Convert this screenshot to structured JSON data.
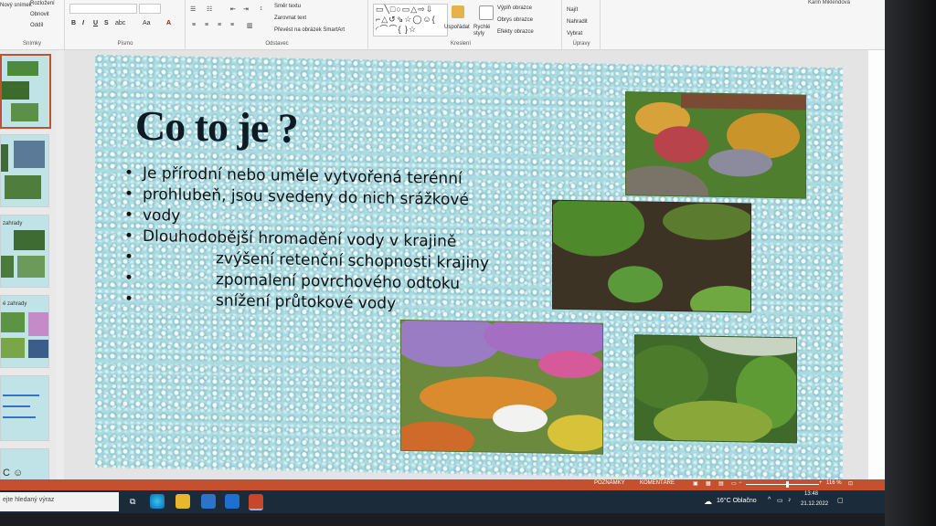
{
  "ribbon": {
    "slides_group": {
      "layout": "Rozložení",
      "reset": "Obnovit",
      "new_slide": "Nový snímek",
      "section": "Oddíl",
      "label": "Snímky"
    },
    "font_group": {
      "label": "Písmo"
    },
    "paragraph_group": {
      "text_direction": "Směr textu",
      "align_text": "Zarovnat text",
      "convert_smartart": "Převést na obrázek SmartArt",
      "label": "Odstavec"
    },
    "drawing_group": {
      "arrange": "Uspořádat",
      "quick_styles": "Rychlé styly",
      "shape_fill": "Výplň obrazce",
      "shape_outline": "Obrys obrazce",
      "shape_effects": "Efekty obrazce",
      "label": "Kreslení"
    },
    "editing_group": {
      "find": "Najít",
      "replace": "Nahradit",
      "select": "Vybrat",
      "label": "Úpravy"
    },
    "user": "Karin Miklendová"
  },
  "left_panel": {
    "thumb3_text": "zahrady",
    "thumb4_text": "é zahrady",
    "bottom_text": "C ☺"
  },
  "slide": {
    "title": "Co to je ?",
    "bullets": [
      {
        "text": "Je přírodní nebo uměle vytvořená terénní"
      },
      {
        "text": "prohlubeň, jsou svedeny do nich srážkové"
      },
      {
        "text": "vody"
      },
      {
        "text": "Dlouhodobější hromadění vody v krajině"
      },
      {
        "text": "zvýšení retenční schopnosti krajiny"
      },
      {
        "text": "zpomalení povrchového odtoku"
      },
      {
        "text": "snížení průtokové vody"
      }
    ]
  },
  "statusbar": {
    "notes": "POZNÁMKY",
    "comments": "KOMENTÁŘE",
    "zoom": "116 %"
  },
  "taskbar": {
    "search_placeholder": "ejte hledaný výraz",
    "weather": "16°C  Oblačno",
    "time": "13:48",
    "date": "21.12.2022"
  },
  "colors": {
    "accent": "#c5502d",
    "slide_bg": "#a9dbe1",
    "taskbar": "#1c2b3a"
  }
}
